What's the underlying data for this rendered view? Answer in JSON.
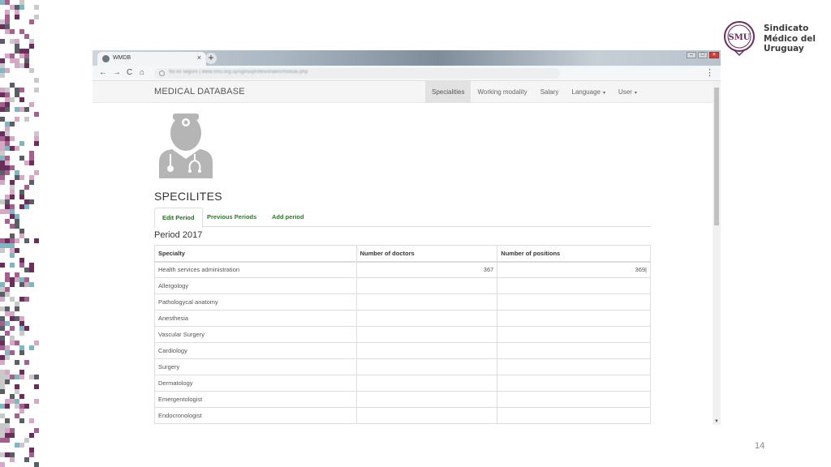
{
  "browser": {
    "tab_title": "WMDB",
    "tab_close": "×",
    "new_tab": "+",
    "url": "No es seguro | www.smu.org.uy/sgmu/profesionales/modulo.php",
    "menu": "⋮",
    "nav": {
      "back": "←",
      "forward": "→",
      "reload": "C",
      "home": "⌂"
    },
    "window_controls": {
      "minimize": "–",
      "maximize": "□",
      "close": "×"
    }
  },
  "navbar": {
    "brand": "MEDICAL DATABASE",
    "items": [
      {
        "label": "Specialities",
        "active": true,
        "caret": false
      },
      {
        "label": "Working modality",
        "active": false,
        "caret": false
      },
      {
        "label": "Salary",
        "active": false,
        "caret": false
      },
      {
        "label": "Language",
        "active": false,
        "caret": true
      },
      {
        "label": "User",
        "active": false,
        "caret": true
      }
    ]
  },
  "page": {
    "title": "SPECILITES",
    "tabs": [
      {
        "label": "Edit Period",
        "active": true
      },
      {
        "label": "Previous Periods",
        "active": false
      },
      {
        "label": "Add period",
        "active": false
      }
    ],
    "period_title": "Period 2017"
  },
  "table": {
    "headers": [
      "Specialty",
      "Number of doctors",
      "Number of positions"
    ],
    "rows": [
      [
        "Health services administration",
        "367",
        "369|"
      ],
      [
        "Allergology",
        "",
        ""
      ],
      [
        "Pathologycal anatomy",
        "",
        ""
      ],
      [
        "Anesthesia",
        "",
        ""
      ],
      [
        "Vascular Surgery",
        "",
        ""
      ],
      [
        "Cardiology",
        "",
        ""
      ],
      [
        "Surgery",
        "",
        ""
      ],
      [
        "Dermatology",
        "",
        ""
      ],
      [
        "Emergentologist",
        "",
        ""
      ],
      [
        "Endocronologist",
        "",
        ""
      ]
    ]
  },
  "logo": {
    "line1": "Sindicato",
    "line2": "Médico del",
    "line3": "Uruguay",
    "emblem_text": "SMU"
  },
  "slide_number": "14",
  "colors": {
    "tab_link_green": "#2a7a2a",
    "logo_purple": "#6b2d5c",
    "pixel_palette": [
      "#6b2d5c",
      "#a4608f",
      "#d4a9c6",
      "#7fb6c2",
      "#5a5f66",
      "#c9c9c9"
    ]
  },
  "icons": {
    "doctor": "doctor-avatar-icon"
  }
}
